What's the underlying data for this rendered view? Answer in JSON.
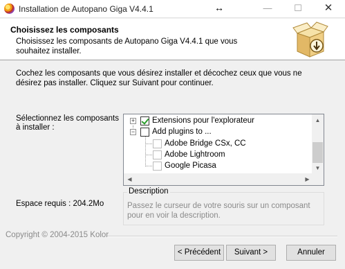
{
  "window": {
    "title": "Installation de Autopano Giga V4.4.1",
    "min_glyph": "—",
    "max_glyph": "☐",
    "close_glyph": "✕",
    "resize_glyph": "↔"
  },
  "header": {
    "title": "Choisissez les composants",
    "subtitle": "Choisissez les composants de Autopano Giga V4.4.1 que vous souhaitez installer.",
    "icon": "installer-box-icon"
  },
  "intro": "Cochez les composants que vous désirez installer et décochez ceux que vous ne désirez pas installer. Cliquez sur Suivant pour continuer.",
  "select_label": "Sélectionnez les composants à installer :",
  "space_label": "Espace requis : 204.2Mo",
  "tree": {
    "items": [
      {
        "label": "Extensions pour l'explorateur",
        "checked": true,
        "expander": "+"
      },
      {
        "label": "Add plugins to ...",
        "checked": false,
        "expander": "−"
      },
      {
        "label": "Adobe Bridge CSx, CC",
        "checked": false
      },
      {
        "label": "Adobe Lightroom",
        "checked": false
      },
      {
        "label": "Google Picasa",
        "checked": false
      }
    ],
    "scroll_up": "▲",
    "scroll_down": "▼",
    "scroll_left": "◀",
    "scroll_right": "▶"
  },
  "description": {
    "legend": "Description",
    "text": "Passez le curseur de votre souris sur un composant pour en voir la description."
  },
  "copyright": "Copyright © 2004-2015 Kolor",
  "buttons": {
    "back": "< Précédent",
    "next": "Suivant >",
    "cancel": "Annuler"
  }
}
